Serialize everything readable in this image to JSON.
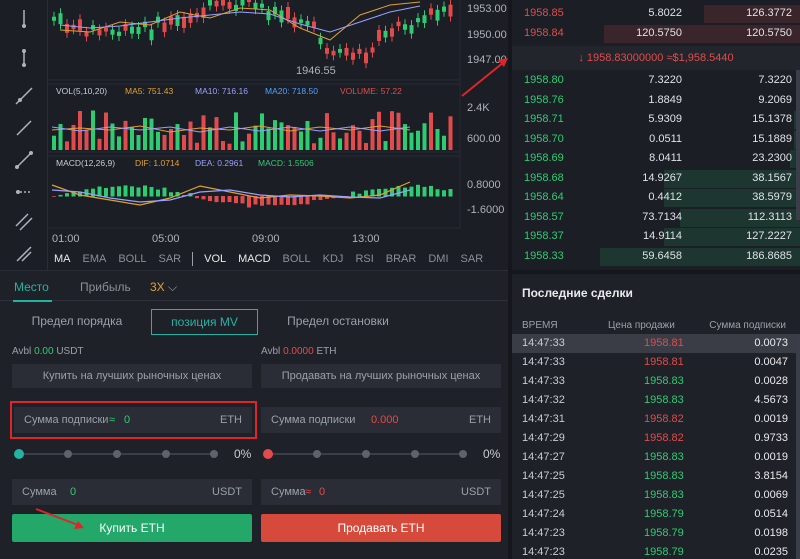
{
  "chart": {
    "price_ticks": [
      "1953.00",
      "1950.00",
      "1947.00"
    ],
    "low_marker": "1946.55",
    "vol_legend": {
      "label": "VOL(5,10,20)",
      "ma5": "MA5: 751.43",
      "ma10": "MA10: 716.16",
      "ma20": "MA20: 718.50",
      "volume": "VOLUME: 57.22"
    },
    "vol_ticks": [
      "2.4K",
      "600.00"
    ],
    "macd_legend": {
      "label": "MACD(12,26,9)",
      "dif": "DIF: 1.0714",
      "dea": "DEA: 0.2961",
      "macd": "MACD: 1.5506"
    },
    "macd_ticks": [
      "0.8000",
      "-1.6000"
    ],
    "time_ticks": [
      "01:00",
      "05:00",
      "09:00",
      "13:00"
    ],
    "tabs": [
      "MA",
      "EMA",
      "BOLL",
      "SAR",
      "VOL",
      "MACD",
      "BOLL",
      "KDJ",
      "RSI",
      "BRAR",
      "DMI",
      "SAR"
    ],
    "colors": {
      "up": "#2ecc71",
      "down": "#e24b4b",
      "ma5": "#e0a030",
      "ma10": "#9aa0ff",
      "ma20": "#4aa3ff"
    }
  },
  "order": {
    "mode_tabs": {
      "place": "Место",
      "profit": "Прибыль",
      "leverage": "3X"
    },
    "type_tabs": {
      "limit": "Предел порядка",
      "market": "позиция MV",
      "stop": "Предел остановки"
    },
    "buy_avbl": {
      "label": "Avbl",
      "value": "0.00",
      "unit": "USDT"
    },
    "sell_avbl": {
      "label": "Avbl",
      "value": "0.0000",
      "unit": "ETH"
    },
    "buy_market_hint": "Купить на лучших рыночных ценах",
    "sell_market_hint": "Продавать на лучших рыночных ценах",
    "buy_amount": {
      "label": "Сумма подписки",
      "approx": "≈",
      "value": "0",
      "unit": "ETH"
    },
    "sell_amount": {
      "label": "Сумма подписки",
      "value": "0.000",
      "unit": "ETH"
    },
    "buy_pct": "0%",
    "sell_pct": "0%",
    "buy_total": {
      "label": "Сумма",
      "value": "0",
      "unit": "USDT"
    },
    "sell_total": {
      "label": "Сумма",
      "approx": "≈",
      "value": "0",
      "unit": "USDT"
    },
    "buy_button": "Купить ETH",
    "sell_button": "Продавать ETH"
  },
  "book": {
    "asks": [
      {
        "price": "1958.85",
        "amount": "5.8022",
        "total": "126.3772",
        "depth": 0.48
      },
      {
        "price": "1958.84",
        "amount": "120.5750",
        "total": "120.5750",
        "depth": 0.98
      }
    ],
    "mid_arrow": "↓",
    "mid_price": "1958.83000000",
    "mid_fiat": "≈$1,958.5440",
    "bids": [
      {
        "price": "1958.80",
        "amount": "7.3220",
        "total": "7.3220",
        "depth": 0.02
      },
      {
        "price": "1958.76",
        "amount": "1.8849",
        "total": "9.2069",
        "depth": 0.02
      },
      {
        "price": "1958.71",
        "amount": "5.9309",
        "total": "15.1378",
        "depth": 0.03
      },
      {
        "price": "1958.70",
        "amount": "0.0511",
        "total": "15.1889",
        "depth": 0.03
      },
      {
        "price": "1958.69",
        "amount": "8.0411",
        "total": "23.2300",
        "depth": 0.05
      },
      {
        "price": "1958.68",
        "amount": "14.9267",
        "total": "38.1567",
        "depth": 0.68
      },
      {
        "price": "1958.64",
        "amount": "0.4412",
        "total": "38.5979",
        "depth": 0.68
      },
      {
        "price": "1958.57",
        "amount": "73.7134",
        "total": "112.3113",
        "depth": 0.6
      },
      {
        "price": "1958.37",
        "amount": "14.9114",
        "total": "127.2227",
        "depth": 0.68
      },
      {
        "price": "1958.33",
        "amount": "59.6458",
        "total": "186.8685",
        "depth": 1.0
      }
    ]
  },
  "trades": {
    "title": "Последние сделки",
    "headers": {
      "time": "ВРЕМЯ",
      "price": "Цена продажи",
      "qty": "Сумма подписки"
    },
    "rows": [
      {
        "time": "14:47:33",
        "price": "1958.81",
        "qty": "0.0073",
        "side": "sell"
      },
      {
        "time": "14:47:33",
        "price": "1958.81",
        "qty": "0.0047",
        "side": "sell"
      },
      {
        "time": "14:47:33",
        "price": "1958.83",
        "qty": "0.0028",
        "side": "buy"
      },
      {
        "time": "14:47:32",
        "price": "1958.83",
        "qty": "4.5673",
        "side": "buy"
      },
      {
        "time": "14:47:31",
        "price": "1958.82",
        "qty": "0.0019",
        "side": "sell"
      },
      {
        "time": "14:47:29",
        "price": "1958.82",
        "qty": "0.9733",
        "side": "sell"
      },
      {
        "time": "14:47:27",
        "price": "1958.83",
        "qty": "0.0019",
        "side": "buy"
      },
      {
        "time": "14:47:25",
        "price": "1958.83",
        "qty": "3.8154",
        "side": "buy"
      },
      {
        "time": "14:47:25",
        "price": "1958.83",
        "qty": "0.0069",
        "side": "buy"
      },
      {
        "time": "14:47:24",
        "price": "1958.79",
        "qty": "0.0514",
        "side": "buy"
      },
      {
        "time": "14:47:23",
        "price": "1958.79",
        "qty": "0.0198",
        "side": "buy"
      },
      {
        "time": "14:47:23",
        "price": "1958.79",
        "qty": "0.0235",
        "side": "buy"
      }
    ]
  }
}
